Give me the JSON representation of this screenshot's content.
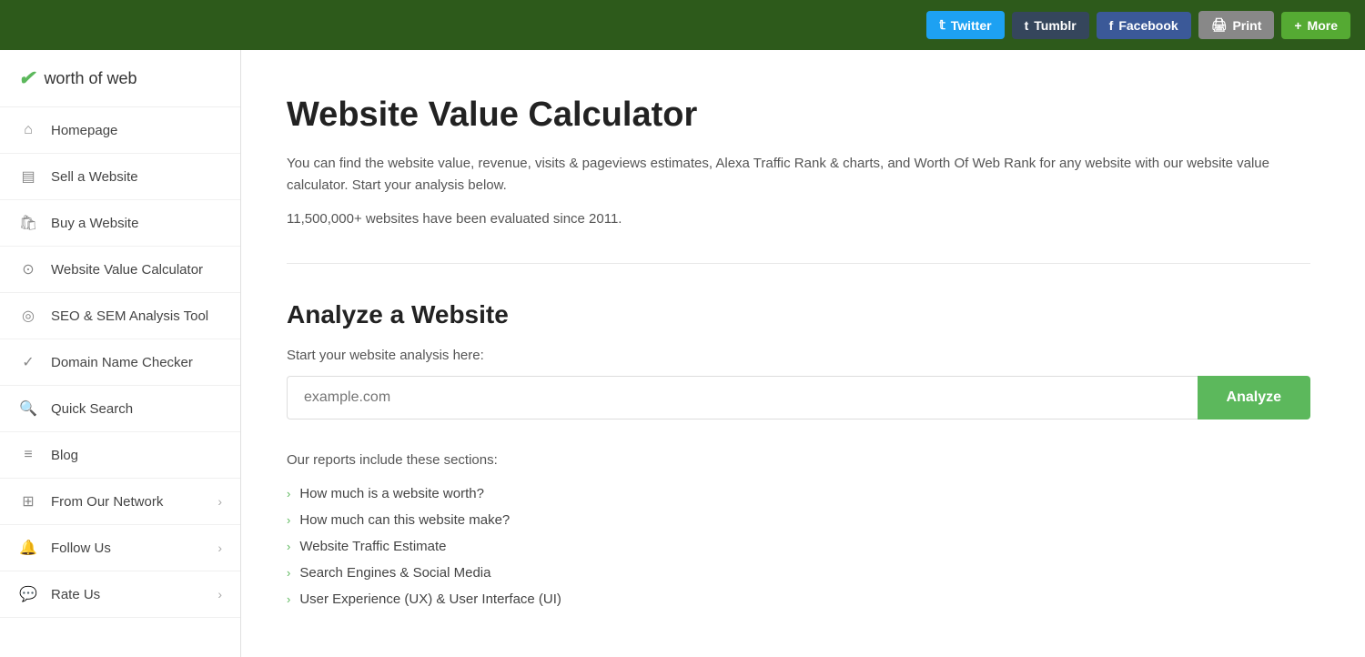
{
  "topbar": {
    "buttons": [
      {
        "id": "twitter",
        "label": "Twitter",
        "class": "twitter",
        "icon": "𝕥"
      },
      {
        "id": "tumblr",
        "label": "Tumblr",
        "class": "tumblr",
        "icon": "t"
      },
      {
        "id": "facebook",
        "label": "Facebook",
        "class": "facebook",
        "icon": "f"
      },
      {
        "id": "print",
        "label": "Print",
        "class": "print",
        "icon": "🖨"
      },
      {
        "id": "more",
        "label": "More",
        "class": "more",
        "icon": "+"
      }
    ]
  },
  "logo": {
    "text": "worth of web"
  },
  "sidebar": {
    "items": [
      {
        "id": "homepage",
        "label": "Homepage",
        "icon": "⌂",
        "has_chevron": false
      },
      {
        "id": "sell-website",
        "label": "Sell a Website",
        "icon": "▤",
        "has_chevron": false
      },
      {
        "id": "buy-website",
        "label": "Buy a Website",
        "icon": "🛍",
        "has_chevron": false
      },
      {
        "id": "website-value-calculator",
        "label": "Website Value Calculator",
        "icon": "⊙",
        "has_chevron": false
      },
      {
        "id": "seo-sem-tool",
        "label": "SEO & SEM Analysis Tool",
        "icon": "◎",
        "has_chevron": false
      },
      {
        "id": "domain-name-checker",
        "label": "Domain Name Checker",
        "icon": "✓",
        "has_chevron": false
      },
      {
        "id": "quick-search",
        "label": "Quick Search",
        "icon": "🔍",
        "has_chevron": false
      },
      {
        "id": "blog",
        "label": "Blog",
        "icon": "≡",
        "has_chevron": false
      },
      {
        "id": "from-our-network",
        "label": "From Our Network",
        "icon": "⊞",
        "has_chevron": true
      },
      {
        "id": "follow-us",
        "label": "Follow Us",
        "icon": "🔔",
        "has_chevron": true
      },
      {
        "id": "rate-us",
        "label": "Rate Us",
        "icon": "💬",
        "has_chevron": true
      }
    ]
  },
  "main": {
    "title": "Website Value Calculator",
    "description": "You can find the website value, revenue, visits & pageviews estimates, Alexa Traffic Rank & charts, and Worth Of Web Rank for any website with our website value calculator. Start your analysis below.",
    "stats": "11,500,000+ websites have been evaluated since 2011.",
    "analyze_section_title": "Analyze a Website",
    "analyze_label": "Start your website analysis here:",
    "analyze_placeholder": "example.com",
    "analyze_button": "Analyze",
    "reports_label": "Our reports include these sections:",
    "report_items": [
      "How much is a website worth?",
      "How much can this website make?",
      "Website Traffic Estimate",
      "Search Engines & Social Media",
      "User Experience (UX) & User Interface (UI)"
    ]
  }
}
